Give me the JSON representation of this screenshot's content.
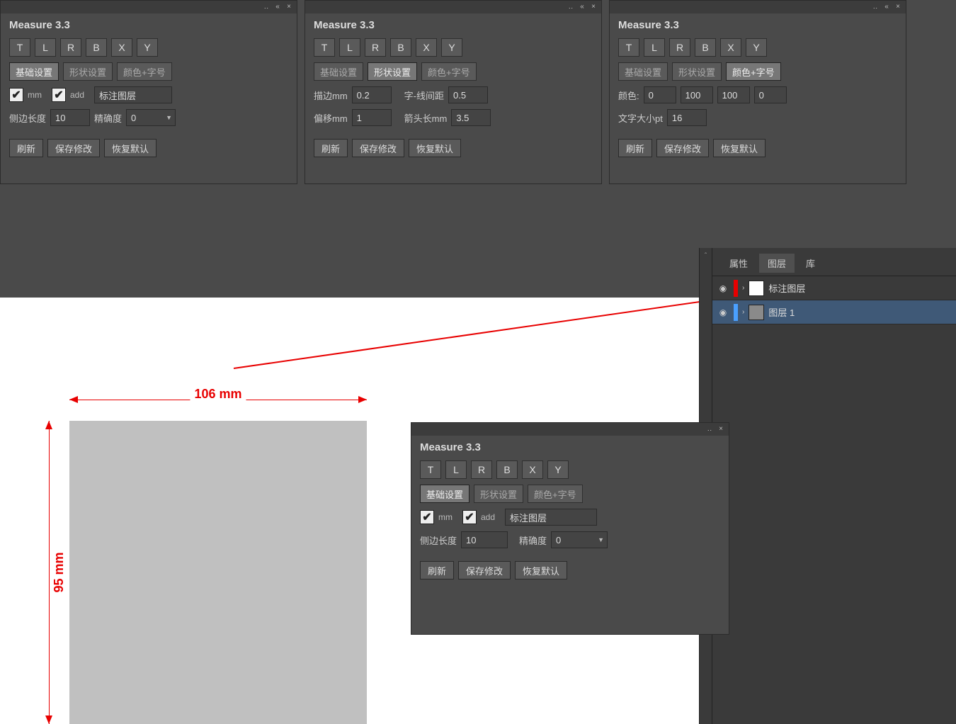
{
  "panel_title": "Measure 3.3",
  "side_buttons": [
    "T",
    "L",
    "R",
    "B",
    "X",
    "Y"
  ],
  "tabs": {
    "basic": "基础设置",
    "shape": "形状设置",
    "color": "颜色+字号"
  },
  "basic": {
    "mm_label": "mm",
    "add_label": "add",
    "layer_name_value": "标注图层",
    "side_len_label": "侧边长度",
    "side_len_value": "10",
    "precision_label": "精确度",
    "precision_value": "0"
  },
  "shape": {
    "margin_label": "描边mm",
    "margin_value": "0.2",
    "gap_label": "字-线间距",
    "gap_value": "0.5",
    "offset_label": "偏移mm",
    "offset_value": "1",
    "arrow_label": "箭头长mm",
    "arrow_value": "3.5"
  },
  "color": {
    "color_label": "颜色:",
    "c": "0",
    "m": "100",
    "y": "100",
    "k": "0",
    "fontsize_label": "文字大小pt",
    "fontsize_value": "16"
  },
  "actions": {
    "refresh": "刷新",
    "save": "保存修改",
    "reset": "恢复默认"
  },
  "layers_tabs": {
    "properties": "属性",
    "layers": "图层",
    "library": "库"
  },
  "layers": [
    {
      "name": "标注图层",
      "color": "#e80000",
      "swatch": "#ffffff"
    },
    {
      "name": "图层 1",
      "color": "#4aa0ff",
      "swatch": "#8a8a8a"
    }
  ],
  "canvas_dims": {
    "width_label": "106 mm",
    "height_label": "95 mm"
  }
}
